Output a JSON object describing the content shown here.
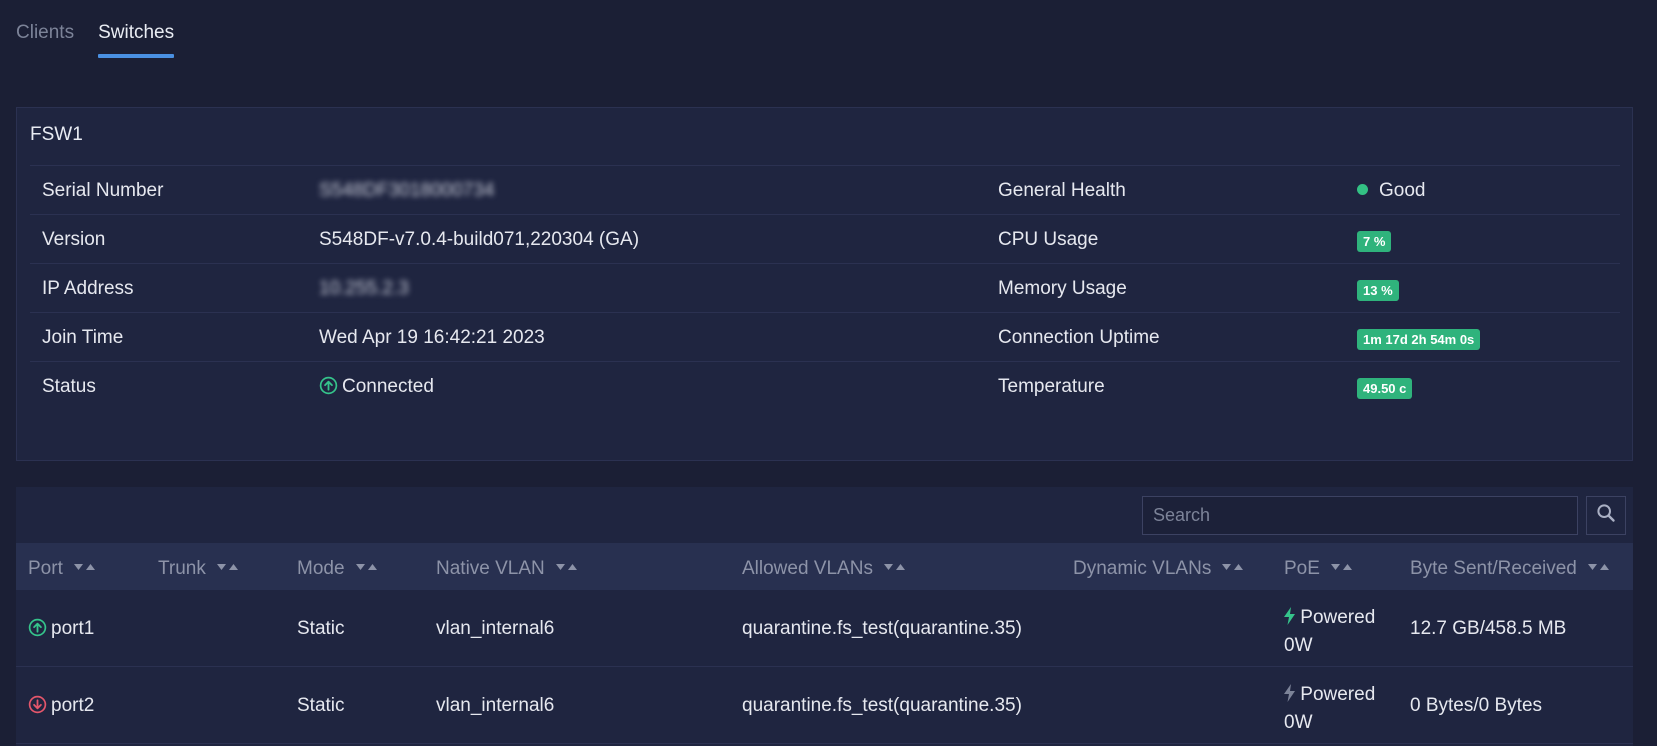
{
  "tabs": [
    {
      "label": "Clients",
      "active": false
    },
    {
      "label": "Switches",
      "active": true
    }
  ],
  "switch": {
    "name": "FSW1",
    "rows": [
      {
        "label": "Serial Number",
        "value": "S548DF3018000734",
        "right_label": "General Health",
        "right_value": "Good"
      },
      {
        "label": "Version",
        "value": "S548DF-v7.0.4-build071,220304 (GA)",
        "right_label": "CPU Usage",
        "right_value": "7 %"
      },
      {
        "label": "IP Address",
        "value": "10.255.2.3",
        "right_label": "Memory Usage",
        "right_value": "13 %"
      },
      {
        "label": "Join Time",
        "value": "Wed Apr 19 16:42:21 2023",
        "right_label": "Connection Uptime",
        "right_value": "1m 17d 2h 54m 0s"
      },
      {
        "label": "Status",
        "value": "Connected",
        "right_label": "Temperature",
        "right_value": "49.50 c"
      }
    ]
  },
  "search": {
    "placeholder": "Search"
  },
  "table": {
    "columns": [
      "Port",
      "Trunk",
      "Mode",
      "Native VLAN",
      "Allowed VLANs",
      "Dynamic VLANs",
      "PoE",
      "Byte Sent/Received"
    ],
    "rows": [
      {
        "port": "port1",
        "status": "up",
        "trunk": "",
        "mode": "Static",
        "native_vlan": "vlan_internal6",
        "allowed_vlans": "quarantine.fs_test(quarantine.35)",
        "dynamic_vlans": "",
        "poe_status": "Powered",
        "poe_watts": "0W",
        "bytes": "12.7 GB/458.5 MB"
      },
      {
        "port": "port2",
        "status": "down",
        "trunk": "",
        "mode": "Static",
        "native_vlan": "vlan_internal6",
        "allowed_vlans": "quarantine.fs_test(quarantine.35)",
        "dynamic_vlans": "",
        "poe_status": "Powered",
        "poe_watts": "0W",
        "bytes": "0 Bytes/0 Bytes"
      }
    ]
  },
  "colors": {
    "accent": "#4a90e2",
    "good": "#33c184",
    "badge": "#2fb37c",
    "port_up": "#35c48b",
    "port_down": "#e4566b",
    "poe_active": "#35c48b",
    "poe_inactive": "#7c8398"
  },
  "icons": {
    "status_connected": "arrow-up-circle-icon",
    "port_up": "arrow-up-circle-icon",
    "port_down": "arrow-down-circle-icon",
    "poe": "lightning-bolt-icon",
    "search": "magnifier-icon",
    "sort": "sort-arrows-icon"
  }
}
